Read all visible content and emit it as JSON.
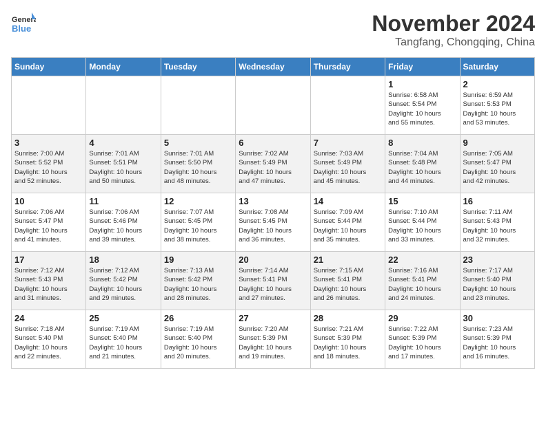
{
  "logo": {
    "general": "General",
    "blue": "Blue"
  },
  "title": "November 2024",
  "subtitle": "Tangfang, Chongqing, China",
  "weekdays": [
    "Sunday",
    "Monday",
    "Tuesday",
    "Wednesday",
    "Thursday",
    "Friday",
    "Saturday"
  ],
  "weeks": [
    [
      {
        "day": "",
        "info": ""
      },
      {
        "day": "",
        "info": ""
      },
      {
        "day": "",
        "info": ""
      },
      {
        "day": "",
        "info": ""
      },
      {
        "day": "",
        "info": ""
      },
      {
        "day": "1",
        "info": "Sunrise: 6:58 AM\nSunset: 5:54 PM\nDaylight: 10 hours\nand 55 minutes."
      },
      {
        "day": "2",
        "info": "Sunrise: 6:59 AM\nSunset: 5:53 PM\nDaylight: 10 hours\nand 53 minutes."
      }
    ],
    [
      {
        "day": "3",
        "info": "Sunrise: 7:00 AM\nSunset: 5:52 PM\nDaylight: 10 hours\nand 52 minutes."
      },
      {
        "day": "4",
        "info": "Sunrise: 7:01 AM\nSunset: 5:51 PM\nDaylight: 10 hours\nand 50 minutes."
      },
      {
        "day": "5",
        "info": "Sunrise: 7:01 AM\nSunset: 5:50 PM\nDaylight: 10 hours\nand 48 minutes."
      },
      {
        "day": "6",
        "info": "Sunrise: 7:02 AM\nSunset: 5:49 PM\nDaylight: 10 hours\nand 47 minutes."
      },
      {
        "day": "7",
        "info": "Sunrise: 7:03 AM\nSunset: 5:49 PM\nDaylight: 10 hours\nand 45 minutes."
      },
      {
        "day": "8",
        "info": "Sunrise: 7:04 AM\nSunset: 5:48 PM\nDaylight: 10 hours\nand 44 minutes."
      },
      {
        "day": "9",
        "info": "Sunrise: 7:05 AM\nSunset: 5:47 PM\nDaylight: 10 hours\nand 42 minutes."
      }
    ],
    [
      {
        "day": "10",
        "info": "Sunrise: 7:06 AM\nSunset: 5:47 PM\nDaylight: 10 hours\nand 41 minutes."
      },
      {
        "day": "11",
        "info": "Sunrise: 7:06 AM\nSunset: 5:46 PM\nDaylight: 10 hours\nand 39 minutes."
      },
      {
        "day": "12",
        "info": "Sunrise: 7:07 AM\nSunset: 5:45 PM\nDaylight: 10 hours\nand 38 minutes."
      },
      {
        "day": "13",
        "info": "Sunrise: 7:08 AM\nSunset: 5:45 PM\nDaylight: 10 hours\nand 36 minutes."
      },
      {
        "day": "14",
        "info": "Sunrise: 7:09 AM\nSunset: 5:44 PM\nDaylight: 10 hours\nand 35 minutes."
      },
      {
        "day": "15",
        "info": "Sunrise: 7:10 AM\nSunset: 5:44 PM\nDaylight: 10 hours\nand 33 minutes."
      },
      {
        "day": "16",
        "info": "Sunrise: 7:11 AM\nSunset: 5:43 PM\nDaylight: 10 hours\nand 32 minutes."
      }
    ],
    [
      {
        "day": "17",
        "info": "Sunrise: 7:12 AM\nSunset: 5:43 PM\nDaylight: 10 hours\nand 31 minutes."
      },
      {
        "day": "18",
        "info": "Sunrise: 7:12 AM\nSunset: 5:42 PM\nDaylight: 10 hours\nand 29 minutes."
      },
      {
        "day": "19",
        "info": "Sunrise: 7:13 AM\nSunset: 5:42 PM\nDaylight: 10 hours\nand 28 minutes."
      },
      {
        "day": "20",
        "info": "Sunrise: 7:14 AM\nSunset: 5:41 PM\nDaylight: 10 hours\nand 27 minutes."
      },
      {
        "day": "21",
        "info": "Sunrise: 7:15 AM\nSunset: 5:41 PM\nDaylight: 10 hours\nand 26 minutes."
      },
      {
        "day": "22",
        "info": "Sunrise: 7:16 AM\nSunset: 5:41 PM\nDaylight: 10 hours\nand 24 minutes."
      },
      {
        "day": "23",
        "info": "Sunrise: 7:17 AM\nSunset: 5:40 PM\nDaylight: 10 hours\nand 23 minutes."
      }
    ],
    [
      {
        "day": "24",
        "info": "Sunrise: 7:18 AM\nSunset: 5:40 PM\nDaylight: 10 hours\nand 22 minutes."
      },
      {
        "day": "25",
        "info": "Sunrise: 7:19 AM\nSunset: 5:40 PM\nDaylight: 10 hours\nand 21 minutes."
      },
      {
        "day": "26",
        "info": "Sunrise: 7:19 AM\nSunset: 5:40 PM\nDaylight: 10 hours\nand 20 minutes."
      },
      {
        "day": "27",
        "info": "Sunrise: 7:20 AM\nSunset: 5:39 PM\nDaylight: 10 hours\nand 19 minutes."
      },
      {
        "day": "28",
        "info": "Sunrise: 7:21 AM\nSunset: 5:39 PM\nDaylight: 10 hours\nand 18 minutes."
      },
      {
        "day": "29",
        "info": "Sunrise: 7:22 AM\nSunset: 5:39 PM\nDaylight: 10 hours\nand 17 minutes."
      },
      {
        "day": "30",
        "info": "Sunrise: 7:23 AM\nSunset: 5:39 PM\nDaylight: 10 hours\nand 16 minutes."
      }
    ]
  ]
}
